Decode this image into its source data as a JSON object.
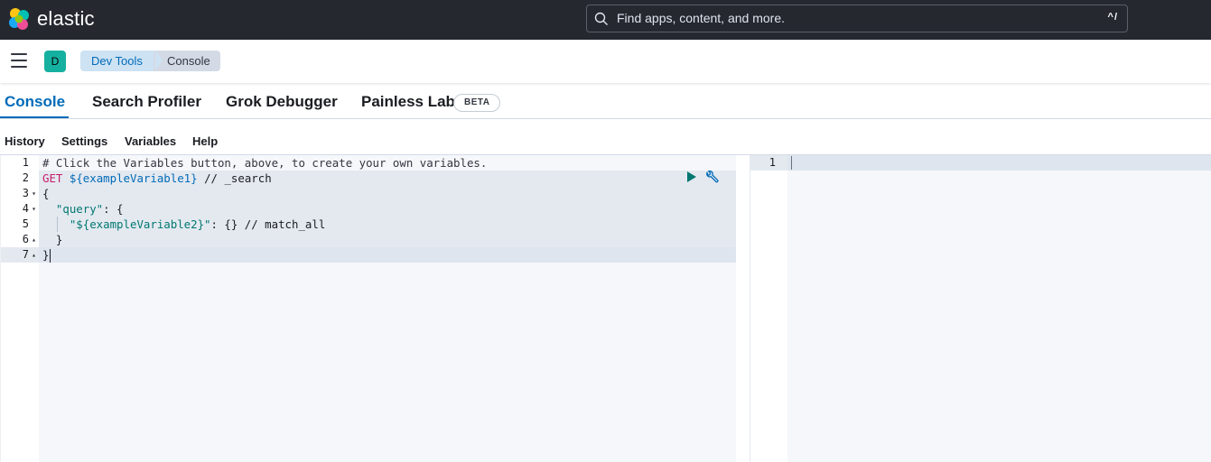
{
  "header": {
    "brand": "elastic",
    "search": {
      "placeholder": "Find apps, content, and more.",
      "shortcut": "^/"
    }
  },
  "subheader": {
    "space_initial": "D",
    "breadcrumbs": [
      "Dev Tools",
      "Console"
    ]
  },
  "tabs": [
    {
      "label": "Console",
      "active": true
    },
    {
      "label": "Search Profiler",
      "active": false
    },
    {
      "label": "Grok Debugger",
      "active": false
    },
    {
      "label": "Painless Lab",
      "active": false
    }
  ],
  "tab_badge": "BETA",
  "menu": [
    "History",
    "Settings",
    "Variables",
    "Help"
  ],
  "editor": {
    "lines": [
      {
        "num": "1",
        "fold": ""
      },
      {
        "num": "2",
        "fold": ""
      },
      {
        "num": "3",
        "fold": "▾"
      },
      {
        "num": "4",
        "fold": "▾"
      },
      {
        "num": "5",
        "fold": ""
      },
      {
        "num": "6",
        "fold": "▴"
      },
      {
        "num": "7",
        "fold": "▴"
      }
    ],
    "code": {
      "comment": "# Click the Variables button, above, to create your own variables.",
      "method": "GET",
      "url": "${exampleVariable1}",
      "url_comment": " // _search",
      "open_brace": "{",
      "query_key": "\"query\"",
      "query_rest": ": {",
      "var_key": "\"${exampleVariable2}\"",
      "var_rest": ": {} // match_all",
      "close_inner": "  }",
      "close_outer": "}"
    }
  },
  "output": {
    "line_num": "1"
  },
  "colors": {
    "accent": "#006bb8",
    "header_bg": "#25282f",
    "play": "#007871"
  }
}
